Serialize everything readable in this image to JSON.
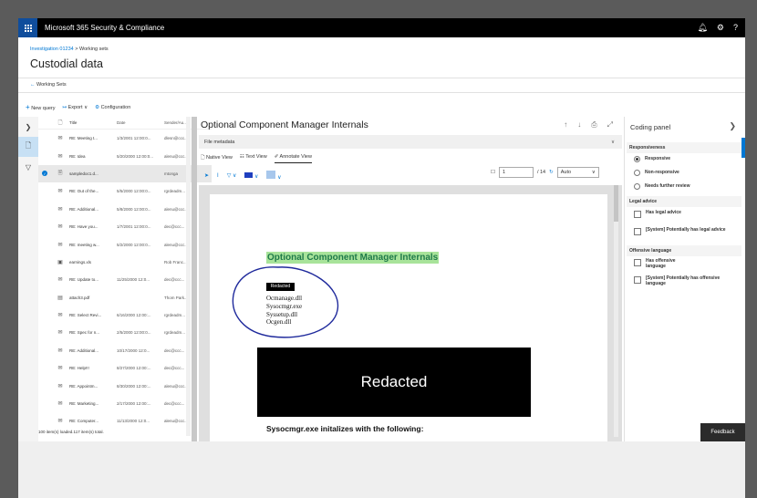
{
  "app": {
    "title": "Microsoft 365 Security & Compliance",
    "icons": [
      "bell-icon",
      "gear-icon",
      "help-icon"
    ],
    "help_glyph": "?"
  },
  "breadcrumb": {
    "link": "Investigation 01234",
    "separator": ">",
    "current": "Working sets"
  },
  "page_title": "Custodial data",
  "back_link": "Working Sets",
  "commands": {
    "new_query": "New query",
    "export": "Export",
    "configuration": "Configuration"
  },
  "list": {
    "headers": {
      "title": "Title",
      "date": "Date",
      "sender": "Sender/Au..."
    },
    "rows": [
      {
        "icon": "mail-icon",
        "title": "RE: Meeting t...",
        "date": "1/3/2001 12:00:0...",
        "sender": "dlesn@ccc..."
      },
      {
        "icon": "mail-icon",
        "title": "RE: Idea",
        "date": "5/20/2000 12:00:0...",
        "sender": "alenu@ccc..."
      },
      {
        "icon": "doc-icon",
        "title": "sampledoc1.d...",
        "date": "",
        "sender": "mtonga",
        "selected": true
      },
      {
        "icon": "mail-icon",
        "title": "RE: Out of the...",
        "date": "5/5/2000 12:00:0...",
        "sender": "rgrdeadm..."
      },
      {
        "icon": "mail-icon",
        "title": "RE: Additional...",
        "date": "5/8/2000 12:00:0...",
        "sender": "alenu@ccc..."
      },
      {
        "icon": "mail-icon",
        "title": "RE: Have you...",
        "date": "1/7/2001 12:00:0...",
        "sender": "dec@ccc..."
      },
      {
        "icon": "mail-icon",
        "title": "RE: meeting w...",
        "date": "5/2/2000 12:00:0...",
        "sender": "alenu@ccc..."
      },
      {
        "icon": "excel-icon",
        "title": "earnings.xls",
        "date": "",
        "sender": "Rob Franc..."
      },
      {
        "icon": "mail-icon",
        "title": "RE: Update to...",
        "date": "11/25/2000 12:0...",
        "sender": "dec@ccc..."
      },
      {
        "icon": "pdf-icon",
        "title": "attach3.pdf",
        "date": "",
        "sender": "Thom Park..."
      },
      {
        "icon": "mail-icon",
        "title": "RE: Select Revi...",
        "date": "6/16/2000 12:00:...",
        "sender": "rgrdeadm..."
      },
      {
        "icon": "mail-icon",
        "title": "RE: Spec for n...",
        "date": "2/5/2000 12:00:0...",
        "sender": "rgrdeadm..."
      },
      {
        "icon": "mail-icon",
        "title": "RE: Additional...",
        "date": "10/17/2000 12:0...",
        "sender": "dec@ccc..."
      },
      {
        "icon": "mail-icon",
        "title": "RE: Help!!!",
        "date": "8/27/2000 12:00:...",
        "sender": "dec@ccc..."
      },
      {
        "icon": "mail-icon",
        "title": "RE: Appointm...",
        "date": "8/30/2000 12:00:...",
        "sender": "alenu@ccc..."
      },
      {
        "icon": "mail-icon",
        "title": "RE: Marketing...",
        "date": "2/17/2000 12:00:...",
        "sender": "dec@ccc..."
      },
      {
        "icon": "mail-icon",
        "title": "RE: Computer...",
        "date": "11/13/2000 12:0...",
        "sender": "alenu@ccc..."
      }
    ],
    "footer": "100 item(s) loaded.117 item(s) total."
  },
  "viewer": {
    "title": "Optional Component Manager Internals",
    "metadata_label": "File metadata",
    "tabs": [
      "Native View",
      "Text View",
      "Annotate View"
    ],
    "active_tab": 2,
    "page_current": "1",
    "page_total": "/ 14",
    "zoom": "Auto"
  },
  "document": {
    "heading": "Optional Component Manager Internals",
    "redacted_small": "Redacted",
    "dll_lines": [
      "Ocmanage.dll",
      "Sysocmgr.exe",
      "Syssetup.dll",
      "Ocgen.dll"
    ],
    "redacted_big": "Redacted",
    "subheading": "Sysocmgr.exe initalizes with the following:"
  },
  "coding_panel": {
    "title": "Coding panel",
    "responsiveness": {
      "label": "Responsiveness",
      "options": [
        "Responsive",
        "Non-responsive",
        "Needs further review"
      ],
      "selected": 0
    },
    "legal_advice": {
      "label": "Legal advice",
      "options": [
        "Has legal advice",
        "[System] Potentially has legal advice"
      ]
    },
    "offensive_language": {
      "label": "Offensive language",
      "options": [
        "Has offensive language",
        "[System] Potentially has offensive language"
      ]
    }
  },
  "feedback": "Feedback",
  "colors": {
    "accent": "#0078d4",
    "suitebar": "#000000",
    "highlight": "#a8e39a",
    "pen": "#1f2a9c"
  }
}
